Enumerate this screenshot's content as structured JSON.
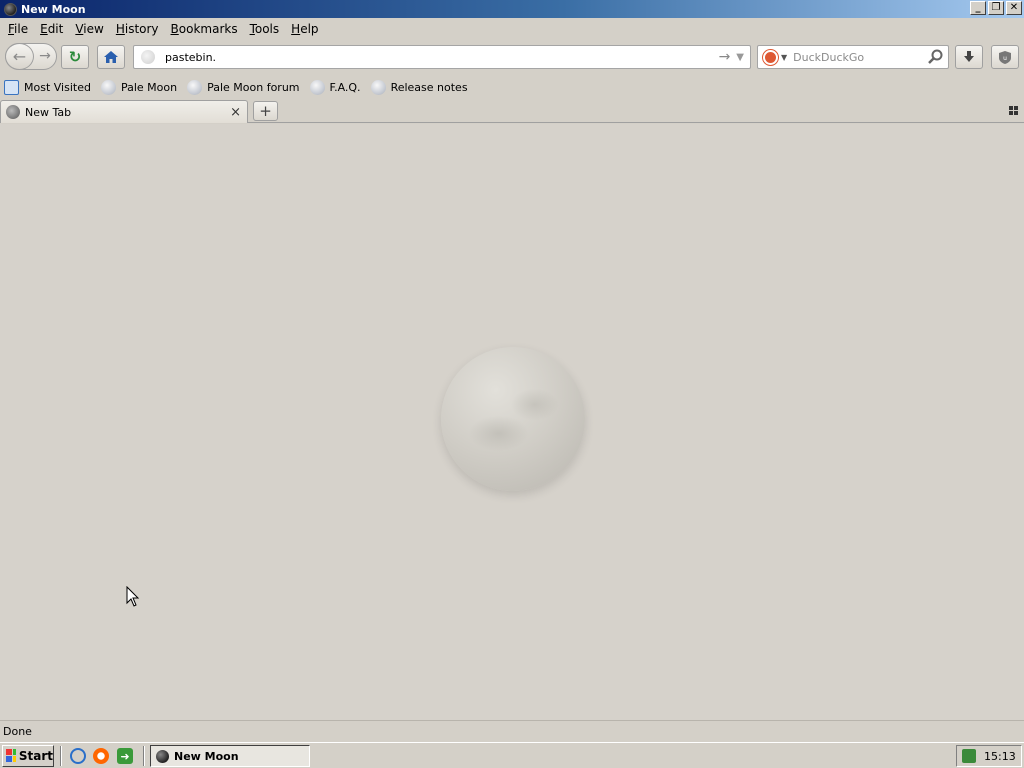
{
  "window": {
    "title": "New Moon"
  },
  "menubar": {
    "items": [
      {
        "label": "File",
        "key": "F",
        "rest": "ile"
      },
      {
        "label": "Edit",
        "key": "E",
        "rest": "dit"
      },
      {
        "label": "View",
        "key": "V",
        "rest": "iew"
      },
      {
        "label": "History",
        "key": "H",
        "rest": "istory"
      },
      {
        "label": "Bookmarks",
        "key": "B",
        "rest": "ookmarks"
      },
      {
        "label": "Tools",
        "key": "T",
        "rest": "ools"
      },
      {
        "label": "Help",
        "key": "H",
        "rest": "elp"
      }
    ]
  },
  "navbar": {
    "url": "pastebin.",
    "search_placeholder": "DuckDuckGo"
  },
  "bookmarks": {
    "items": [
      "Most Visited",
      "Pale Moon",
      "Pale Moon forum",
      "F.A.Q.",
      "Release notes"
    ]
  },
  "tabs": {
    "items": [
      {
        "label": "New Tab"
      }
    ],
    "close_glyph": "×",
    "new_tab_glyph": "+"
  },
  "statusbar": {
    "text": "Done"
  },
  "taskbar": {
    "start_label": "Start",
    "task_label": "New Moon",
    "clock": "15:13"
  }
}
